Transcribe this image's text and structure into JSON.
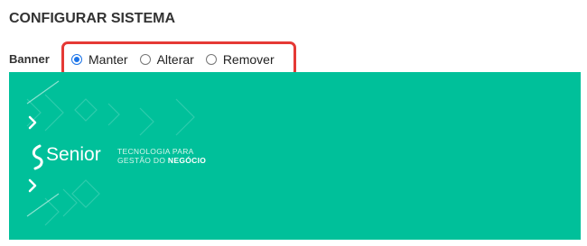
{
  "page": {
    "title": "CONFIGURAR SISTEMA"
  },
  "banner_field": {
    "label": "Banner",
    "options": [
      {
        "label": "Manter",
        "checked": true
      },
      {
        "label": "Alterar",
        "checked": false
      },
      {
        "label": "Remover",
        "checked": false
      }
    ]
  },
  "banner_image": {
    "background_color": "#00c09a",
    "brand_name": "Senior",
    "tagline_line1": "TECNOLOGIA PARA",
    "tagline_line2_a": "GESTÃO DO ",
    "tagline_line2_b": "NEGÓCIO"
  },
  "colors": {
    "highlight_border": "#e53935",
    "radio_accent": "#1a73e8"
  }
}
